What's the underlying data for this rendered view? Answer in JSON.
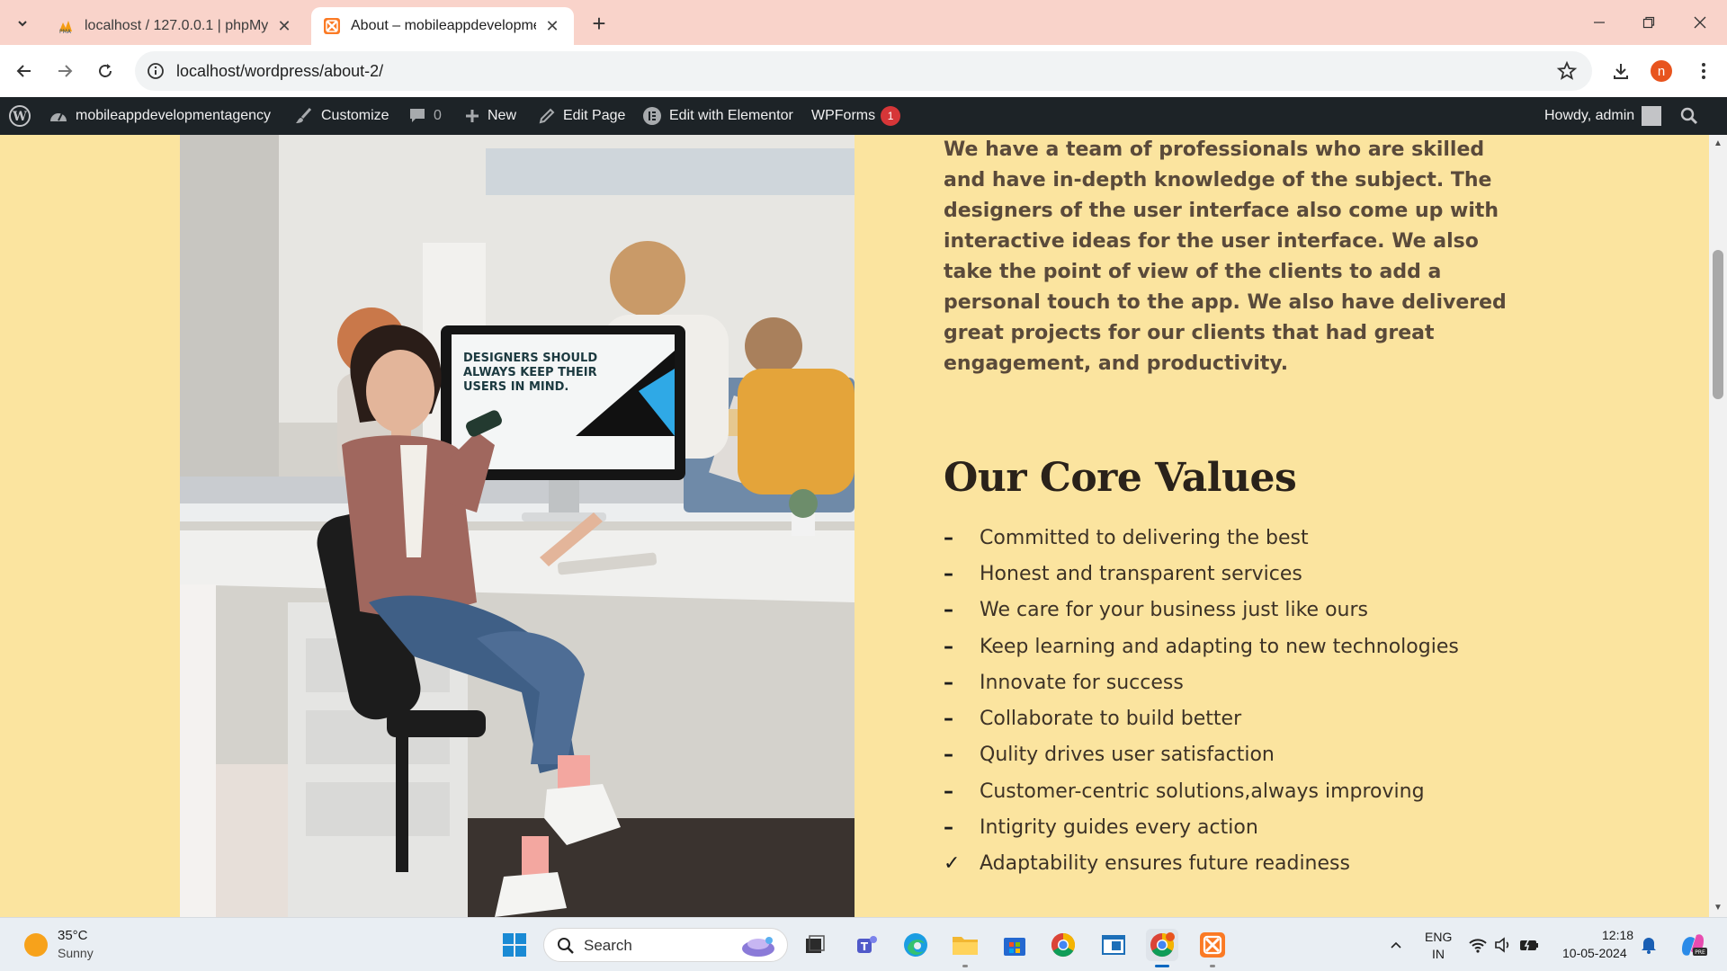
{
  "browser": {
    "tabs": [
      {
        "title": "localhost / 127.0.0.1 | phpMyAdmin",
        "icon": "phpmyadmin-icon",
        "active": false
      },
      {
        "title": "About – mobileappdevelopmentagency",
        "icon": "xampp-icon",
        "active": true
      }
    ],
    "url": "localhost/wordpress/about-2/",
    "profile_initial": "n"
  },
  "adminbar": {
    "site_name": "mobileappdevelopmentagency",
    "customize": "Customize",
    "comments_count": "0",
    "new": "New",
    "edit_page": "Edit Page",
    "edit_elementor": "Edit with Elementor",
    "wpforms": "WPForms",
    "wpforms_badge": "1",
    "howdy": "Howdy, admin"
  },
  "page": {
    "intro": "We have a team of professionals who are skilled and have in-depth knowledge of the subject. The designers of the user interface also come up with interactive ideas for the user interface. We also take the point of view of the clients to add a personal touch to the app. We also have delivered great projects for our clients that had great engagement, and productivity.",
    "values_title": "Our Core Values",
    "values": [
      {
        "text": "Committed to delivering the best",
        "mark": "–"
      },
      {
        "text": "Honest and transparent services",
        "mark": "–"
      },
      {
        "text": "We care for your business just like ours",
        "mark": "–"
      },
      {
        "text": "Keep learning and adapting to new technologies",
        "mark": "–"
      },
      {
        "text": "Innovate for success",
        "mark": "–"
      },
      {
        "text": "Collaborate to build better",
        "mark": "–"
      },
      {
        "text": "Qulity drives user satisfaction",
        "mark": "–"
      },
      {
        "text": "Customer-centric solutions,always improving",
        "mark": "–"
      },
      {
        "text": "Intigrity guides every action",
        "mark": "–"
      },
      {
        "text": "Adaptability ensures future readiness",
        "mark": "✓"
      }
    ],
    "photo_screen_text": "DESIGNERS SHOULD ALWAYS KEEP THEIR USERS IN MIND."
  },
  "taskbar": {
    "weather_temp": "35°C",
    "weather_cond": "Sunny",
    "search_label": "Search",
    "lang_top": "ENG",
    "lang_bottom": "IN",
    "time": "12:18",
    "date": "10-05-2024"
  },
  "colors": {
    "page_bg": "#fbe49f",
    "adminbar_bg": "#1d2327",
    "tabstrip_bg": "#f9d3ca",
    "badge": "#d63638"
  }
}
